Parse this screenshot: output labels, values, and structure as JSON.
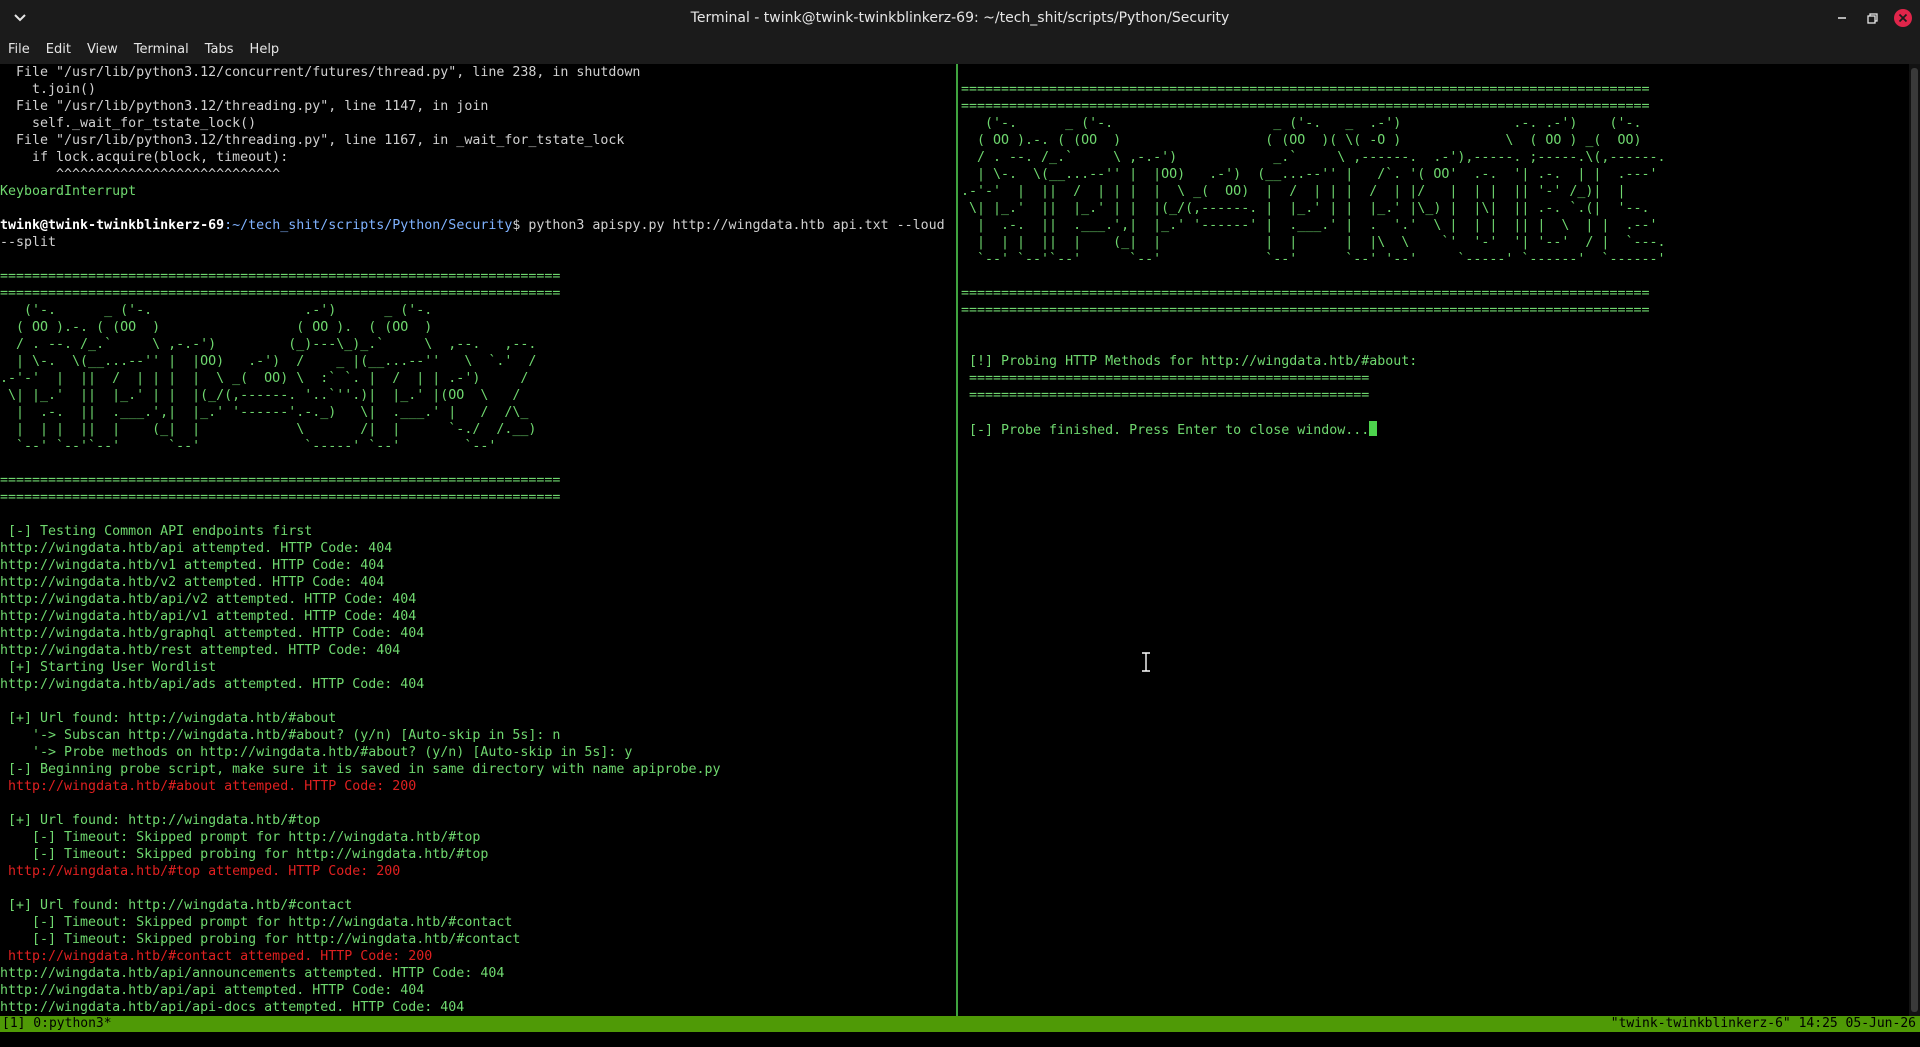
{
  "window": {
    "title": "Terminal - twink@twink-twinkblinkerz-69: ~/tech_shit/scripts/Python/Security",
    "icons": {
      "menu": "chevron-down-icon",
      "minimize": "minimize-icon",
      "maximize": "maximize-icon",
      "close": "close-icon"
    },
    "close_color": "#e0254a"
  },
  "menu": [
    "File",
    "Edit",
    "View",
    "Terminal",
    "Tabs",
    "Help"
  ],
  "colors": {
    "text": "#6fd86f",
    "error": "#e02020",
    "status_bar": "#4f9a06",
    "divider": "#3fa33f"
  },
  "left_pane": {
    "lines": [
      {
        "cls": "w",
        "text": "  File \"/usr/lib/python3.12/concurrent/futures/thread.py\", line 238, in shutdown"
      },
      {
        "cls": "w",
        "text": "    t.join()"
      },
      {
        "cls": "w",
        "text": "  File \"/usr/lib/python3.12/threading.py\", line 1147, in join"
      },
      {
        "cls": "w",
        "text": "    self._wait_for_tstate_lock()"
      },
      {
        "cls": "w",
        "text": "  File \"/usr/lib/python3.12/threading.py\", line 1167, in _wait_for_tstate_lock"
      },
      {
        "cls": "w",
        "text": "    if lock.acquire(block, timeout):"
      },
      {
        "cls": "w",
        "text": "       ^^^^^^^^^^^^^^^^^^^^^^^^^^^^"
      },
      {
        "cls": "g",
        "text": "KeyboardInterrupt"
      },
      {
        "cls": "g",
        "text": ""
      },
      {
        "cls": "prompt",
        "user": "twink@twink-twinkblinkerz-69",
        "path": ":~/tech_shit/scripts/Python/Security",
        "cmd": "$ python3 apispy.py http://wingdata.htb api.txt --loud"
      },
      {
        "cls": "w",
        "text": "--split"
      },
      {
        "cls": "g",
        "text": ""
      },
      {
        "cls": "g",
        "text": "======================================================================"
      },
      {
        "cls": "g",
        "text": "======================================================================"
      },
      {
        "cls": "g",
        "text": "   ('-.      _ ('-.                   .-')      _ ('-."
      },
      {
        "cls": "g",
        "text": "  ( OO ).-. ( (OO  )                 ( OO ).  ( (OO  )"
      },
      {
        "cls": "g",
        "text": "  / . --. /_.`     \\ ,-.-')         (_)---\\_)_.`     \\  ,--.   ,--."
      },
      {
        "cls": "g",
        "text": "  | \\-.  \\(__...--'' |  |OO)   .-')  /    _ |(__...--''   \\  `.'  /"
      },
      {
        "cls": "g",
        "text": ".-'-'  |  ||  /  | | |  |  \\ _(  OO) \\  :` `. |  /  | | .-')     /"
      },
      {
        "cls": "g",
        "text": " \\| |_.'  ||  |_.' | |  |(_/(,------. '..`''.)|  |_.' |(OO  \\   /"
      },
      {
        "cls": "g",
        "text": "  |  .-.  ||  .___.',|  |_.' '------'.-._)   \\|  .___.' |   /  /\\_"
      },
      {
        "cls": "g",
        "text": "  |  | |  ||  |    (_|  |            \\       /|  |      `-./  /.__)"
      },
      {
        "cls": "g",
        "text": "  `--' `--'`--'      `--'             `-----' `--'        `--'"
      },
      {
        "cls": "g",
        "text": ""
      },
      {
        "cls": "g",
        "text": "======================================================================"
      },
      {
        "cls": "g",
        "text": "======================================================================"
      },
      {
        "cls": "g",
        "text": ""
      },
      {
        "cls": "g",
        "text": " [-] Testing Common API endpoints first"
      },
      {
        "cls": "g",
        "text": "http://wingdata.htb/api attempted. HTTP Code: 404"
      },
      {
        "cls": "g",
        "text": "http://wingdata.htb/v1 attempted. HTTP Code: 404"
      },
      {
        "cls": "g",
        "text": "http://wingdata.htb/v2 attempted. HTTP Code: 404"
      },
      {
        "cls": "g",
        "text": "http://wingdata.htb/api/v2 attempted. HTTP Code: 404"
      },
      {
        "cls": "g",
        "text": "http://wingdata.htb/api/v1 attempted. HTTP Code: 404"
      },
      {
        "cls": "g",
        "text": "http://wingdata.htb/graphql attempted. HTTP Code: 404"
      },
      {
        "cls": "g",
        "text": "http://wingdata.htb/rest attempted. HTTP Code: 404"
      },
      {
        "cls": "g",
        "text": " [+] Starting User Wordlist"
      },
      {
        "cls": "g",
        "text": "http://wingdata.htb/api/ads attempted. HTTP Code: 404"
      },
      {
        "cls": "g",
        "text": ""
      },
      {
        "cls": "g",
        "text": " [+] Url found: http://wingdata.htb/#about"
      },
      {
        "cls": "g",
        "text": "    '-> Subscan http://wingdata.htb/#about? (y/n) [Auto-skip in 5s]: n"
      },
      {
        "cls": "g",
        "text": "    '-> Probe methods on http://wingdata.htb/#about? (y/n) [Auto-skip in 5s]: y"
      },
      {
        "cls": "g",
        "text": " [-] Beginning probe script, make sure it is saved in same directory with name apiprobe.py"
      },
      {
        "cls": "r",
        "text": " http://wingdata.htb/#about attemped. HTTP Code: 200"
      },
      {
        "cls": "g",
        "text": ""
      },
      {
        "cls": "g",
        "text": " [+] Url found: http://wingdata.htb/#top"
      },
      {
        "cls": "g",
        "text": "    [-] Timeout: Skipped prompt for http://wingdata.htb/#top"
      },
      {
        "cls": "g",
        "text": "    [-] Timeout: Skipped probing for http://wingdata.htb/#top"
      },
      {
        "cls": "r",
        "text": " http://wingdata.htb/#top attemped. HTTP Code: 200"
      },
      {
        "cls": "g",
        "text": ""
      },
      {
        "cls": "g",
        "text": " [+] Url found: http://wingdata.htb/#contact"
      },
      {
        "cls": "g",
        "text": "    [-] Timeout: Skipped prompt for http://wingdata.htb/#contact"
      },
      {
        "cls": "g",
        "text": "    [-] Timeout: Skipped probing for http://wingdata.htb/#contact"
      },
      {
        "cls": "r",
        "text": " http://wingdata.htb/#contact attemped. HTTP Code: 200"
      },
      {
        "cls": "g",
        "text": "http://wingdata.htb/api/announcements attempted. HTTP Code: 404"
      },
      {
        "cls": "g",
        "text": "http://wingdata.htb/api/api attempted. HTTP Code: 404"
      },
      {
        "cls": "g",
        "text": "http://wingdata.htb/api/api-docs attempted. HTTP Code: 404"
      }
    ]
  },
  "right_pane": {
    "lines": [
      {
        "cls": "g",
        "text": ""
      },
      {
        "cls": "g",
        "text": "======================================================================================"
      },
      {
        "cls": "g",
        "text": "======================================================================================"
      },
      {
        "cls": "g",
        "text": "   ('-.      _ ('-.                    _ ('-.   _  .-')              .-. .-')    ('-."
      },
      {
        "cls": "g",
        "text": "  ( OO ).-. ( (OO  )                  ( (OO  )( \\( -O )             \\  ( OO ) _(  OO)"
      },
      {
        "cls": "g",
        "text": "  / . --. /_.`     \\ ,-.-')            _.`     \\ ,------.  .-'),-----. ;-----.\\(,------."
      },
      {
        "cls": "g",
        "text": "  | \\-.  \\(__...--'' |  |OO)   .-')  (__...--'' |   /`. '( OO'  .-.  '| .-.  | |  .---'"
      },
      {
        "cls": "g",
        "text": ".-'-'  |  ||  /  | | |  |  \\ _(  OO)  |  /  | | |  /  | |/   |  | |  || '-' /_)|  |"
      },
      {
        "cls": "g",
        "text": " \\| |_.'  ||  |_.' | |  |(_/(,------. |  |_.' | |  |_.' |\\_) |  |\\|  || .-. `.(|  '--."
      },
      {
        "cls": "g",
        "text": "  |  .-.  ||  .___.',|  |_.' '------' |  .___.' |  .  '.'  \\ |  | |  || |  \\  | |  .--'"
      },
      {
        "cls": "g",
        "text": "  |  | |  ||  |    (_|  |             |  |      |  |\\  \\    `'  '-'  '| '--'  / |  `---."
      },
      {
        "cls": "g",
        "text": "  `--' `--'`--'      `--'             `--'      `--' '--'     `-----' `------'  `------'"
      },
      {
        "cls": "g",
        "text": ""
      },
      {
        "cls": "g",
        "text": "======================================================================================"
      },
      {
        "cls": "g",
        "text": "======================================================================================"
      },
      {
        "cls": "g",
        "text": ""
      },
      {
        "cls": "g",
        "text": ""
      },
      {
        "cls": "g",
        "text": " [!] Probing HTTP Methods for http://wingdata.htb/#about:"
      },
      {
        "cls": "g",
        "text": " =================================================="
      },
      {
        "cls": "g",
        "text": " =================================================="
      },
      {
        "cls": "g",
        "text": ""
      },
      {
        "cls": "cursorline",
        "text": " [-] Probe finished. Press Enter to close window..."
      }
    ]
  },
  "status_bar": {
    "left": "[1] 0:python3*",
    "right": "\"twink-twinkblinkerz-6\" 14:25 05-Jun-26"
  }
}
